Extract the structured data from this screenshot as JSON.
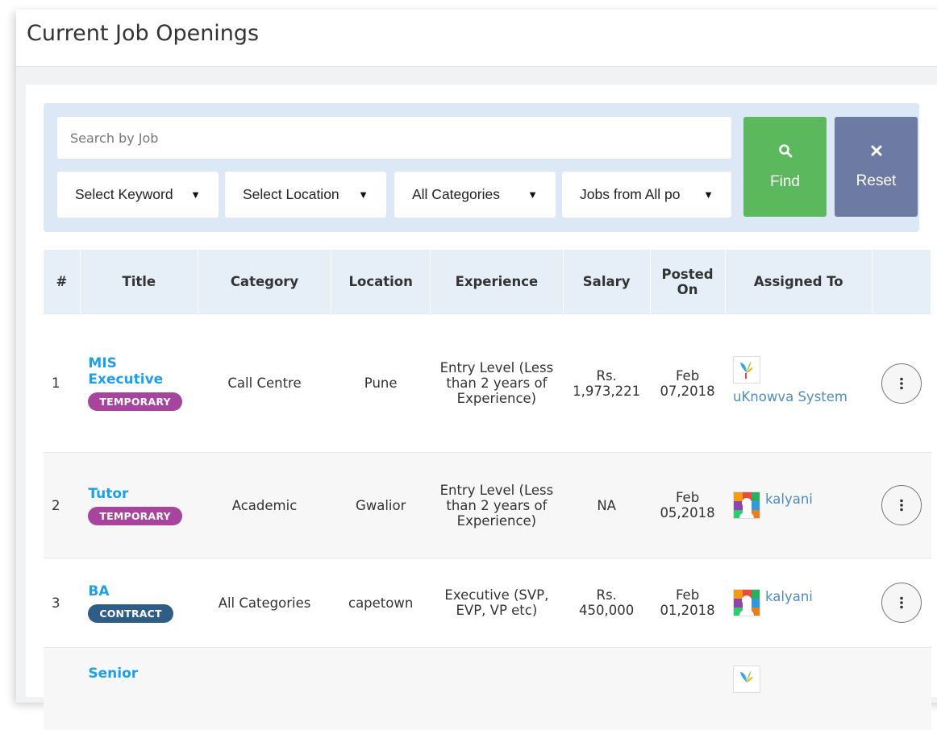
{
  "header": {
    "title": "Current Job Openings"
  },
  "search": {
    "placeholder": "Search by Job",
    "keyword_select": "Select Keyword",
    "location_select": "Select Location",
    "category_select": "All Categories",
    "portal_select": "Jobs from All po",
    "find_label": "Find",
    "reset_label": "Reset"
  },
  "table": {
    "columns": [
      "#",
      "Title",
      "Category",
      "Location",
      "Experience",
      "Salary",
      "Posted On",
      "Assigned To",
      ""
    ],
    "rows": [
      {
        "num": "1",
        "title": "MIS Executive",
        "badge": "TEMPORARY",
        "category": "Call Centre",
        "location": "Pune",
        "experience": "Entry Level (Less than 2 years of Experience)",
        "salary": "Rs. 1,973,221",
        "posted": "Feb 07,2018",
        "assigned": "uKnowva System"
      },
      {
        "num": "2",
        "title": "Tutor",
        "badge": "TEMPORARY",
        "category": "Academic",
        "location": "Gwalior",
        "experience": "Entry Level (Less than 2 years of Experience)",
        "salary": "NA",
        "posted": "Feb 05,2018",
        "assigned": "kalyani"
      },
      {
        "num": "3",
        "title": "BA",
        "badge": "CONTRACT",
        "category": "All Categories",
        "location": "capetown",
        "experience": "Executive (SVP, EVP, VP etc)",
        "salary": "Rs. 450,000",
        "posted": "Feb 01,2018",
        "assigned": "kalyani"
      },
      {
        "num": "",
        "title": "Senior",
        "badge": "",
        "category": "",
        "location": "",
        "experience": "",
        "salary": "",
        "posted": "",
        "assigned": ""
      }
    ]
  },
  "colors": {
    "find": "#5cb85c",
    "reset": "#6d7aa3",
    "link": "#1ea0e8",
    "temporary": "#a6449e",
    "contract": "#2e5d87"
  },
  "icons": {
    "find": "search-icon",
    "reset": "close-icon",
    "row_action": "more-vertical-icon"
  }
}
